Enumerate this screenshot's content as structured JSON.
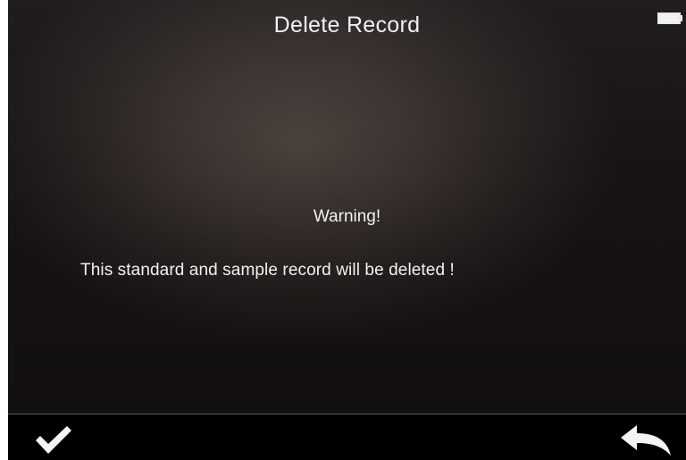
{
  "header": {
    "title": "Delete Record",
    "battery_icon": "battery-full-icon"
  },
  "dialog": {
    "warning": "Warning!",
    "message": "This standard and sample record will be deleted !"
  },
  "toolbar": {
    "confirm_icon": "checkmark-icon",
    "back_icon": "return-arrow-icon"
  },
  "colors": {
    "text": "#f2f2f2",
    "toolbar_bg": "#000000",
    "screen_bg": "#3a322f"
  }
}
